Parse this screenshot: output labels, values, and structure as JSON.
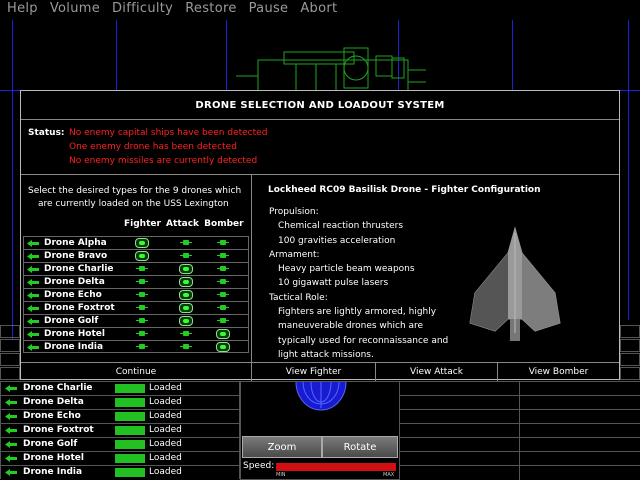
{
  "menu": [
    "Help",
    "Volume",
    "Difficulty",
    "Restore",
    "Pause",
    "Abort"
  ],
  "dialog": {
    "title": "DRONE SELECTION AND LOADOUT SYSTEM",
    "status_label": "Status:",
    "status_lines": [
      "No enemy capital ships have been detected",
      "One enemy drone has been detected",
      "No enemy missiles are currently detected"
    ],
    "instructions_line1": "Select the desired types for the 9 drones which",
    "instructions_line2": "are currently loaded on the USS Lexington",
    "column_headers": "Fighter Attack Bomber",
    "drones": [
      {
        "name": "Drone Alpha",
        "selection": "Fighter"
      },
      {
        "name": "Drone Bravo",
        "selection": "Fighter"
      },
      {
        "name": "Drone Charlie",
        "selection": "Attack"
      },
      {
        "name": "Drone Delta",
        "selection": "Attack"
      },
      {
        "name": "Drone Echo",
        "selection": "Attack"
      },
      {
        "name": "Drone Foxtrot",
        "selection": "Attack"
      },
      {
        "name": "Drone Golf",
        "selection": "Attack"
      },
      {
        "name": "Drone Hotel",
        "selection": "Bomber"
      },
      {
        "name": "Drone India",
        "selection": "Bomber"
      }
    ],
    "craft_title": "Lockheed RC09 Basilisk Drone - Fighter Configuration",
    "description": {
      "propulsion_h": "Propulsion:",
      "propulsion_1": "Chemical reaction thrusters",
      "propulsion_2": "100 gravities acceleration",
      "armament_h": "Armament:",
      "armament_1": "Heavy particle beam weapons",
      "armament_2": "10 gigawatt pulse lasers",
      "role_h": "Tactical Role:",
      "role_1": "Fighters are lightly armored, highly",
      "role_2": "maneuverable drones which are",
      "role_3": "typically used for reconnaissance and",
      "role_4": "light attack missions."
    },
    "buttons": {
      "continue": "Continue",
      "view_fighter": "View Fighter",
      "view_attack": "View Attack",
      "view_bomber": "View Bomber"
    }
  },
  "status_list": [
    {
      "name": "Drone Charlie",
      "status": "Loaded"
    },
    {
      "name": "Drone Delta",
      "status": "Loaded"
    },
    {
      "name": "Drone Echo",
      "status": "Loaded"
    },
    {
      "name": "Drone Foxtrot",
      "status": "Loaded"
    },
    {
      "name": "Drone Golf",
      "status": "Loaded"
    },
    {
      "name": "Drone Hotel",
      "status": "Loaded"
    },
    {
      "name": "Drone India",
      "status": "Loaded"
    }
  ],
  "viewer": {
    "zoom_label": "Zoom",
    "rotate_label": "Rotate",
    "speed_label": "Speed:",
    "speed_min": "MIN",
    "speed_max": "MAX",
    "speed_level": 1.0
  },
  "colors": {
    "status_red": "#ff2020",
    "loaded_green": "#22c022",
    "grid_blue": "#2020d8",
    "speed_red": "#d01010"
  }
}
